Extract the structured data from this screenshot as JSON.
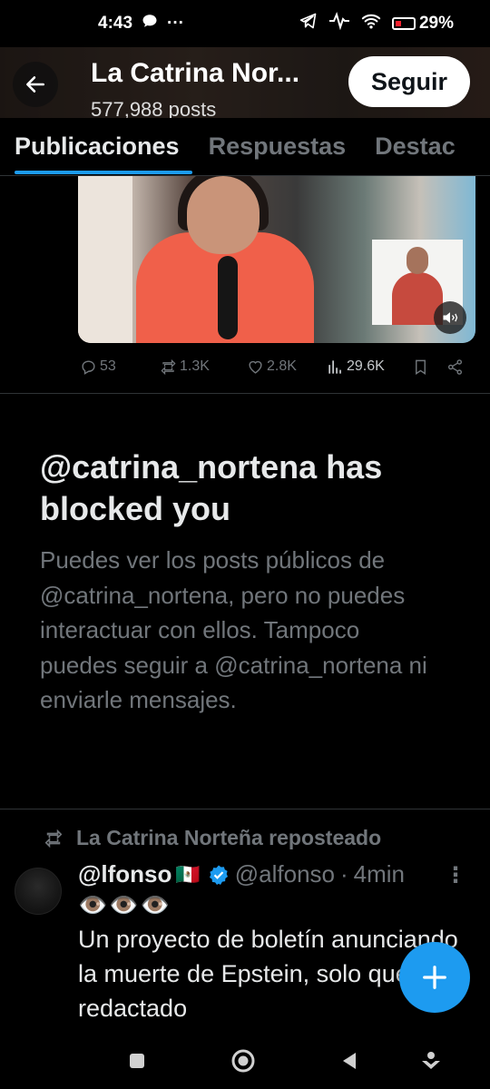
{
  "status_bar": {
    "time": "4:43",
    "more_indicator": "···",
    "battery": "29%",
    "icons": [
      "chat-bubble-icon",
      "telegram-icon",
      "pulse-icon",
      "wifi-icon",
      "battery-icon"
    ]
  },
  "header": {
    "profile_name": "La Catrina Nor...",
    "post_count": "577,988 posts",
    "follow_label": "Seguir"
  },
  "tabs": [
    {
      "label": "Publicaciones",
      "active": true
    },
    {
      "label": "Respuestas",
      "active": false
    },
    {
      "label": "Destac",
      "active": false
    }
  ],
  "tweet_actions": {
    "replies": "53",
    "reposts": "1.3K",
    "likes": "2.8K",
    "views": "29.6K"
  },
  "blocked": {
    "title": "@catrina_nortena has blocked you",
    "body": "Puedes ver los posts públicos de @catrina_nortena, pero no puedes interactuar con ellos. Tampoco puedes seguir a @catrina_nortena ni enviarle mensajes."
  },
  "repost": {
    "label": "La Catrina Norteña reposteado",
    "author_name": "@lfonso",
    "author_flag": "🇲🇽",
    "handle": "@alfonso",
    "separator": "·",
    "time": "4min",
    "emoji_line": "👁️👁️👁️",
    "text": "Un proyecto de boletín anunciando la muerte de Epstein, solo que está redactado"
  },
  "colors": {
    "accent": "#1d9bf0",
    "muted": "#71767b",
    "text": "#e7e9ea",
    "background": "#000000"
  }
}
